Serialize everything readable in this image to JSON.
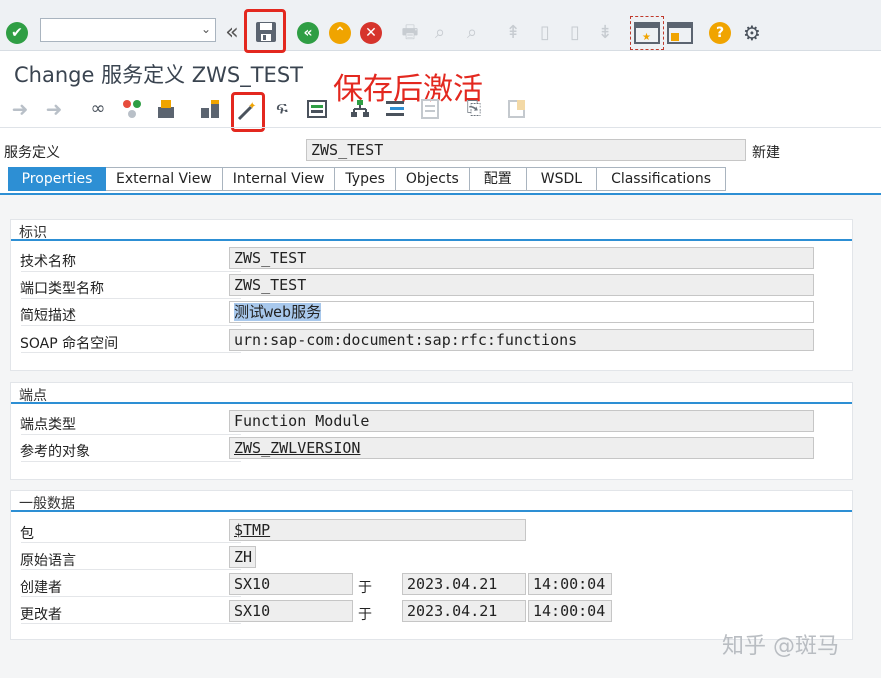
{
  "toolbar": {
    "command_field_value": "",
    "icons": [
      "enter-icon",
      "back-double-chevron-icon",
      "save-icon",
      "back-icon",
      "exit-icon",
      "cancel-icon",
      "print-icon",
      "find-icon",
      "find-next-icon",
      "first-page-icon",
      "previous-page-icon",
      "next-page-icon",
      "last-page-icon",
      "new-session-icon",
      "shortcut-icon",
      "help-icon",
      "settings-icon"
    ]
  },
  "header": {
    "title": "Change 服务定义 ZWS_TEST",
    "annotation": "保存后激活"
  },
  "app_toolbar": {
    "icons": [
      "back-arrow-icon",
      "forward-arrow-icon",
      "display-change-icon",
      "other-object-icon",
      "activate-icon",
      "check-icon",
      "wand-icon",
      "where-used-icon",
      "object-list-icon",
      "hierarchy-icon",
      "navigation-icon",
      "document-icon",
      "attachment-icon",
      "note-icon"
    ]
  },
  "service": {
    "label": "服务定义",
    "value": "ZWS_TEST",
    "status": "新建"
  },
  "tabs": [
    "Properties",
    "External View",
    "Internal View",
    "Types",
    "Objects",
    "配置",
    "WSDL",
    "Classifications"
  ],
  "groups": {
    "identification": {
      "title": "标识",
      "tech_name_label": "技术名称",
      "tech_name_value": "ZWS_TEST",
      "port_type_label": "端口类型名称",
      "port_type_value": "ZWS_TEST",
      "short_desc_label": "简短描述",
      "short_desc_value": "测试web服务",
      "soap_ns_label": "SOAP 命名空间",
      "soap_ns_value": "urn:sap-com:document:sap:rfc:functions"
    },
    "endpoint": {
      "title": "端点",
      "type_label": "端点类型",
      "type_value": "Function Module",
      "ref_label": "参考的对象",
      "ref_value": "ZWS_ZWLVERSION"
    },
    "general": {
      "title": "一般数据",
      "package_label": "包",
      "package_value": "$TMP",
      "lang_label": "原始语言",
      "lang_value": "ZH",
      "created_label": "创建者",
      "created_by": "SX10",
      "created_at_word": "于",
      "created_date": "2023.04.21",
      "created_time": "14:00:04",
      "changed_label": "更改者",
      "changed_by": "SX10",
      "changed_at_word": "于",
      "changed_date": "2023.04.21",
      "changed_time": "14:00:04"
    }
  },
  "watermark": "知乎 @斑马",
  "colors": {
    "accent": "#2d8fd4",
    "annotation_red": "#e3281f",
    "enter_green": "#2f9e44",
    "back_green": "#2f9e44",
    "exit_orange": "#f0a400",
    "cancel_red": "#d6342c",
    "help_orange": "#f0a400"
  }
}
